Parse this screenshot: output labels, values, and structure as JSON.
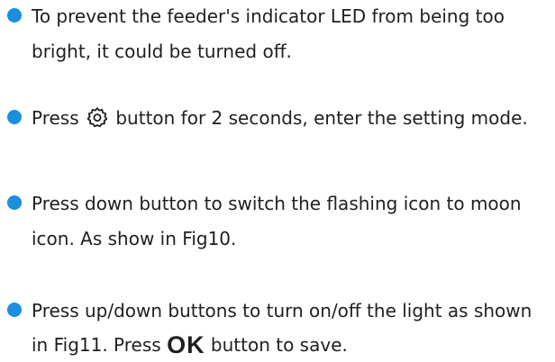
{
  "colors": {
    "bullet": "#1a8fe0",
    "text": "#1f1f1f"
  },
  "items": [
    {
      "line1": "To prevent the feeder's indicator LED from being too",
      "line2": "bright, it could be turned off."
    },
    {
      "before_icon": "Press",
      "icon": "gear-icon",
      "after_icon": "button for 2 seconds, enter the setting mode."
    },
    {
      "line1": "Press down button to switch the flashing icon to moon",
      "line2": "icon. As show in Fig10."
    },
    {
      "line1": "Press up/down buttons to turn on/off the light as shown",
      "line2_before": "in Fig11. Press",
      "ok_label": "OK",
      "line2_after": "button to save."
    }
  ]
}
